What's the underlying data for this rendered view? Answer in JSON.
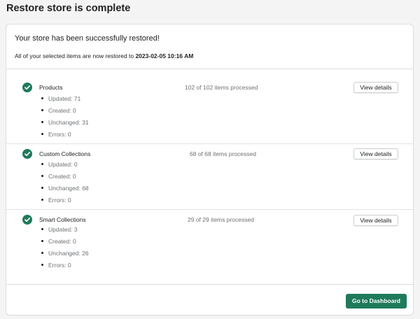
{
  "page": {
    "title": "Restore store is complete"
  },
  "summary": {
    "heading": "Your store has been successfully restored!",
    "message_prefix": "All of your selected items are now restored to ",
    "restored_at": "2023-02-05 10:16 AM"
  },
  "sections": [
    {
      "title": "Products",
      "processed": "102 of 102 items processed",
      "stats": [
        "Updated: 71",
        "Created: 0",
        "Unchanged: 31",
        "Errors: 0"
      ],
      "button": "View details"
    },
    {
      "title": "Custom Collections",
      "processed": "68 of 68 items processed",
      "stats": [
        "Updated: 0",
        "Created: 0",
        "Unchanged: 68",
        "Errors: 0"
      ],
      "button": "View details"
    },
    {
      "title": "Smart Collections",
      "processed": "29 of 29 items processed",
      "stats": [
        "Updated: 3",
        "Created: 0",
        "Unchanged: 26",
        "Errors: 0"
      ],
      "button": "View details"
    }
  ],
  "footer": {
    "dashboard_button": "Go to Dashboard"
  },
  "icons": {
    "section_status": "check-circle-icon"
  },
  "colors": {
    "primary": "#1f7a5c",
    "check": "#1f7a5c"
  }
}
